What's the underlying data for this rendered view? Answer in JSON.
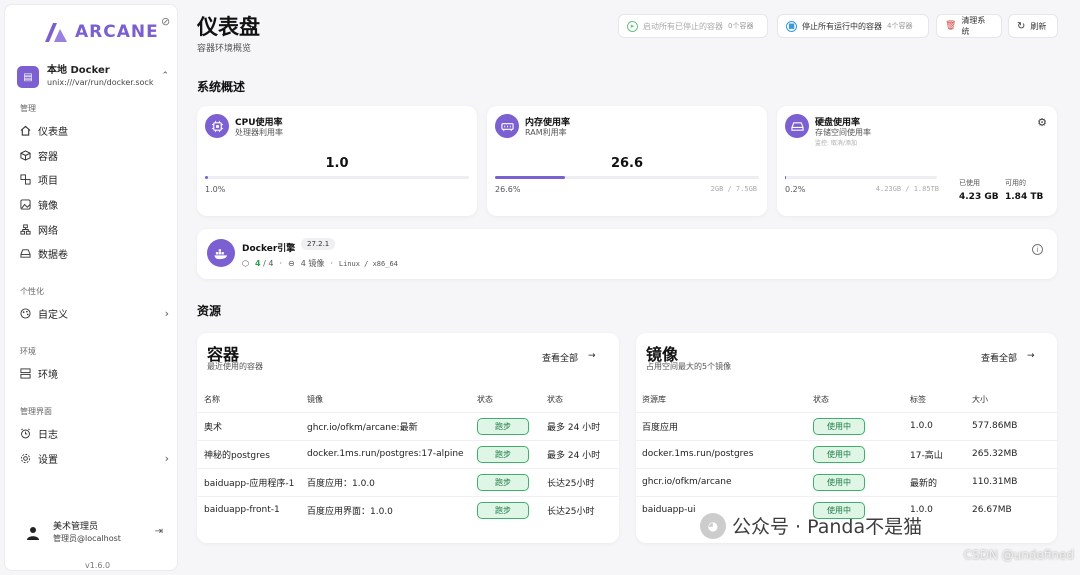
{
  "sidebar": {
    "logo_text": "ARCANE",
    "env_name": "本地 Docker",
    "env_path": "unix:///var/run/docker.sock",
    "sections": {
      "manage": "管理",
      "personal": "个性化",
      "environment": "环境",
      "admin": "管理界面"
    },
    "items": {
      "dashboard": "仪表盘",
      "containers": "容器",
      "projects": "项目",
      "images": "镜像",
      "networks": "网络",
      "volumes": "数据卷",
      "customize": "自定义",
      "environments": "环境",
      "logs": "日志",
      "settings": "设置"
    },
    "user_name": "美术管理员",
    "user_role": "管理员@localhost",
    "version": "v1.6.0"
  },
  "header": {
    "title": "仪表盘",
    "subtitle": "容器环境概览",
    "start_all": "启动所有已停止的容器",
    "start_count": "0个容器",
    "stop_all": "停止所有运行中的容器",
    "stop_count": "4个容器",
    "prune": "清理系统",
    "refresh": "刷新"
  },
  "overview": {
    "heading": "系统概述",
    "cpu": {
      "title": "CPU使用率",
      "sub": "处理器利用率",
      "value": "1.0",
      "pct": "1.0%",
      "fill": 0.01
    },
    "memory": {
      "title": "内存使用率",
      "sub": "RAM利用率",
      "value": "26.6",
      "pct": "26.6%",
      "detail": "2GB / 7.5GB",
      "fill": 0.266
    },
    "disk": {
      "title": "硬盘使用率",
      "sub": "存储空间使用率",
      "sub2": "监控: 取消/添加",
      "pct": "0.2%",
      "detail": "4.23GB / 1.85TB",
      "fill": 0.002,
      "used_label": "已使用",
      "used": "4.23 GB",
      "avail_label": "可用的",
      "avail": "1.84 TB"
    }
  },
  "engine": {
    "title": "Docker引擎",
    "version": "27.2.1",
    "running": "4",
    "total": "/ 4",
    "images": "4 镜像",
    "platform": "Linux / x86_64"
  },
  "resources": {
    "heading": "资源",
    "containers": {
      "title": "容器",
      "sub": "最近使用的容器",
      "view_all": "查看全部",
      "headers": [
        "名称",
        "镜像",
        "状态",
        "状态"
      ],
      "rows": [
        [
          "奥术",
          "ghcr.io/ofkm/arcane:最新",
          "跑步",
          "最多 24 小时"
        ],
        [
          "神秘的postgres",
          "docker.1ms.run/postgres:17-alpine",
          "跑步",
          "最多 24 小时"
        ],
        [
          "baiduapp-应用程序-1",
          "百度应用：1.0.0",
          "跑步",
          "长达25小时"
        ],
        [
          "baiduapp-front-1",
          "百度应用界面：1.0.0",
          "跑步",
          "长达25小时"
        ]
      ]
    },
    "images": {
      "title": "镜像",
      "sub": "占用空间最大的5个镜像",
      "view_all": "查看全部",
      "headers": [
        "资源库",
        "状态",
        "标签",
        "大小"
      ],
      "rows": [
        [
          "百度应用",
          "使用中",
          "1.0.0",
          "577.86MB"
        ],
        [
          "docker.1ms.run/postgres",
          "使用中",
          "17-高山",
          "265.32MB"
        ],
        [
          "ghcr.io/ofkm/arcane",
          "使用中",
          "最新的",
          "110.31MB"
        ],
        [
          "baiduapp-ui",
          "使用中",
          "1.0.0",
          "26.67MB"
        ]
      ]
    }
  },
  "watermark": {
    "text": "公众号 · Panda不是猫",
    "csdn": "CSDN @undefined"
  },
  "colors": {
    "accent": "#7c5fd0",
    "success": "#3fb06b"
  }
}
